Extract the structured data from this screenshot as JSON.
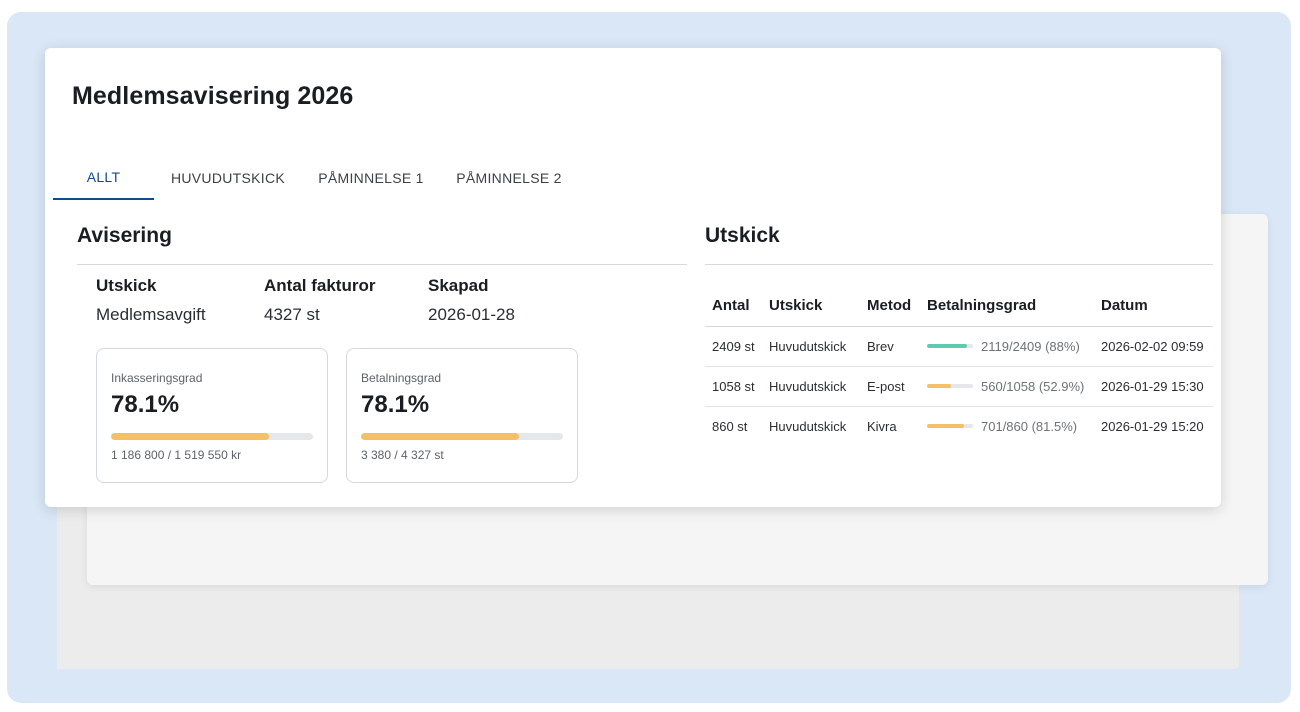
{
  "page": {
    "title": "Medlemsavisering 2026"
  },
  "tabs": [
    {
      "label": "ALLT",
      "active": true
    },
    {
      "label": "HUVUDUTSKICK",
      "active": false
    },
    {
      "label": "PÅMINNELSE 1",
      "active": false
    },
    {
      "label": "PÅMINNELSE 2",
      "active": false
    }
  ],
  "avisering": {
    "title": "Avisering",
    "info": [
      {
        "label": "Utskick",
        "value": "Medlemsavgift"
      },
      {
        "label": "Antal fakturor",
        "value": "4327 st"
      },
      {
        "label": "Skapad",
        "value": "2026-01-28"
      }
    ],
    "stats": [
      {
        "label": "Inkasseringsgrad",
        "value": "78.1%",
        "progress": 0.781,
        "sub": "1 186 800 / 1 519 550 kr"
      },
      {
        "label": "Betalningsgrad",
        "value": "78.1%",
        "progress": 0.781,
        "sub": "3 380 / 4 327 st"
      }
    ]
  },
  "utskick": {
    "title": "Utskick",
    "columns": [
      "Antal",
      "Utskick",
      "Metod",
      "Betalningsgrad",
      "Datum"
    ],
    "rows": [
      {
        "antal": "2409 st",
        "utskick": "Huvudutskick",
        "metod": "Brev",
        "grad_text": "2119/2409 (88%)",
        "grad": 0.88,
        "color": "#5ccbae",
        "datum": "2026-02-02 09:59"
      },
      {
        "antal": "1058 st",
        "utskick": "Huvudutskick",
        "metod": "E-post",
        "grad_text": "560/1058 (52.9%)",
        "grad": 0.529,
        "color": "#f4c065",
        "datum": "2026-01-29 15:30"
      },
      {
        "antal": "860 st",
        "utskick": "Huvudutskick",
        "metod": "Kivra",
        "grad_text": "701/860 (81.5%)",
        "grad": 0.815,
        "color": "#f4c065",
        "datum": "2026-01-29 15:20"
      }
    ]
  },
  "colors": {
    "accent": "#0f4c8c",
    "progress_yellow": "#f4c065",
    "progress_green": "#5ccbae",
    "background_frame": "#d9e7f6"
  }
}
